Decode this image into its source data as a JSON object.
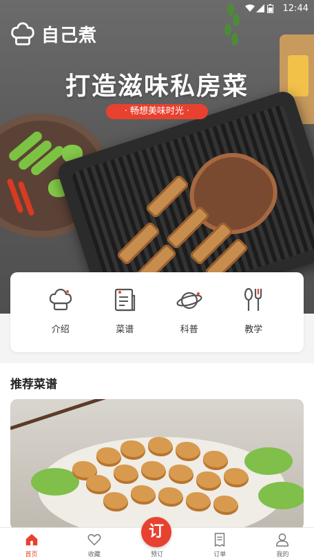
{
  "status_bar": {
    "time": "12:44"
  },
  "brand": {
    "name": "自己煮"
  },
  "hero": {
    "title": "打造滋味私房菜",
    "subtitle": "· 畅想美味时光 ·"
  },
  "categories": [
    {
      "label": "介绍",
      "icon": "chef-hat-icon"
    },
    {
      "label": "菜谱",
      "icon": "recipe-list-icon"
    },
    {
      "label": "科普",
      "icon": "planet-icon"
    },
    {
      "label": "教学",
      "icon": "utensils-icon"
    }
  ],
  "recommended": {
    "title": "推荐菜谱"
  },
  "tabbar": {
    "items": [
      {
        "label": "首页",
        "icon": "home-icon",
        "active": true
      },
      {
        "label": "收藏",
        "icon": "heart-icon",
        "active": false
      },
      {
        "label": "预订",
        "icon": "order-icon",
        "active": false
      },
      {
        "label": "订单",
        "icon": "receipt-icon",
        "active": false
      },
      {
        "label": "我的",
        "icon": "user-icon",
        "active": false
      }
    ],
    "center_button": "订"
  },
  "colors": {
    "accent": "#e8412f",
    "text": "#333333",
    "background": "#f4f4f4"
  }
}
